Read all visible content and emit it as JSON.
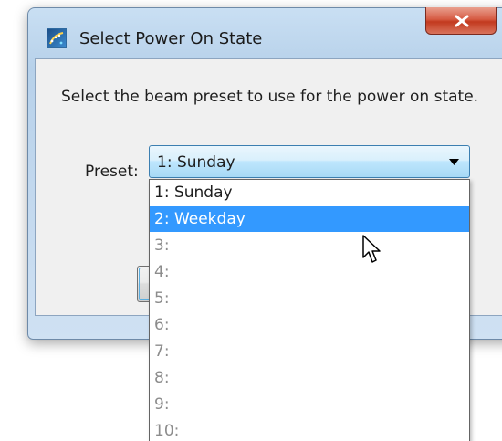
{
  "window": {
    "title": "Select Power On State",
    "close_glyph": "x",
    "icon": "app-icon"
  },
  "dialog": {
    "instruction": "Select the beam preset to use for the power on state.",
    "preset_label": "Preset:"
  },
  "combo": {
    "value": "1: Sunday",
    "arrow_icon": "chevron-down-icon"
  },
  "dropdown": {
    "options": [
      "1: Sunday",
      "2: Weekday",
      "3:",
      "4:",
      "5:",
      "6:",
      "7:",
      "8:",
      "9:",
      "10:"
    ],
    "highlighted": "2: Weekday"
  },
  "colors": {
    "selection": "#3399ff",
    "empty_option_text": "#8c8c8c",
    "close_button": "#c2391e",
    "combo_border": "#3c7fb1"
  }
}
